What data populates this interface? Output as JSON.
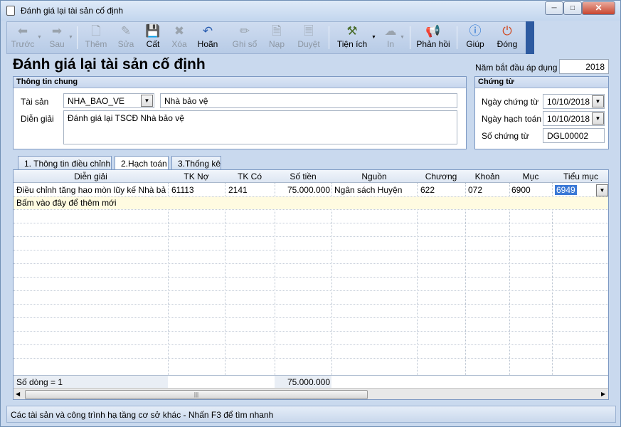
{
  "window": {
    "title": "Đánh giá lại tài sản cố định",
    "min_icon": "minimize-icon",
    "max_icon": "maximize-icon",
    "close_icon": "close-icon"
  },
  "toolbar": {
    "prev": "Trước",
    "next": "Sau",
    "add": "Thêm",
    "edit": "Sửa",
    "save": "Cất",
    "delete": "Xóa",
    "undo": "Hoãn",
    "post": "Ghi sổ",
    "load": "Nạp",
    "approve": "Duyệt",
    "utilities": "Tiện ích",
    "print": "In",
    "feedback": "Phản hồi",
    "help": "Giúp",
    "close": "Đóng"
  },
  "page": {
    "heading": "Đánh giá lại tài sản cố định",
    "year_label": "Năm bắt đầu áp dụng",
    "year_value": "2018"
  },
  "general": {
    "title": "Thông tin chung",
    "asset_label": "Tài sản",
    "asset_code": "NHA_BAO_VE",
    "asset_name": "Nhà bảo vệ",
    "desc_label": "Diễn giải",
    "desc_value": "Đánh giá lại TSCĐ Nhà bảo vệ"
  },
  "voucher": {
    "title": "Chứng từ",
    "voucher_date_label": "Ngày chứng từ",
    "voucher_date": "10/10/2018",
    "posting_date_label": "Ngày hạch toán",
    "posting_date": "10/10/2018",
    "number_label": "Số chứng từ",
    "number": "DGL00002"
  },
  "tabs": [
    "1. Thông tin điều chỉnh",
    "2.Hạch toán",
    "3.Thống kê"
  ],
  "grid": {
    "columns": [
      "Diễn giải",
      "TK Nợ",
      "TK Có",
      "Số tiền",
      "Nguồn",
      "Chương",
      "Khoản",
      "Mục",
      "Tiểu mục"
    ],
    "rows": [
      [
        "Điều chỉnh tăng hao mòn lũy kế Nhà bả...",
        "61113",
        "2141",
        "75.000.000",
        "Ngân sách Huyện",
        "622",
        "072",
        "6900",
        "6949"
      ]
    ],
    "new_row_hint": "Bấm vào đây để thêm mới",
    "row_count": "Số dòng = 1",
    "total": "75.000.000"
  },
  "status": "Các tài sản và công trình hạ tầng cơ sở khác - Nhấn F3 để tìm nhanh"
}
